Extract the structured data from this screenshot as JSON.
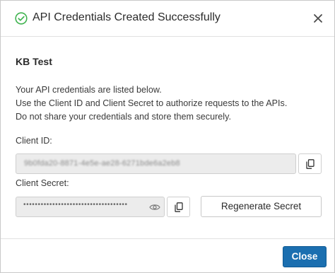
{
  "dialog": {
    "title": "API Credentials Created Successfully",
    "status_icon": "check-circle-icon",
    "close_icon": "close-icon"
  },
  "content": {
    "name": "KB Test",
    "description_lines": [
      "Your API credentials are listed below.",
      "Use the Client ID and Client Secret to authorize requests to the APIs.",
      "Do not share your credentials and store them securely."
    ]
  },
  "client_id": {
    "label": "Client ID:",
    "value": "9b0fda20-8871-4e5e-ae28-6271bde6a2eb8",
    "copy_icon": "copy-icon"
  },
  "client_secret": {
    "label": "Client Secret:",
    "masked_value": "••••••••••••••••••••••••••••••••••••",
    "visibility_icon": "eye-icon",
    "copy_icon": "copy-icon",
    "regenerate_label": "Regenerate Secret"
  },
  "footer": {
    "close_label": "Close"
  },
  "colors": {
    "success": "#3fb34f",
    "primary": "#1b6fb0",
    "input_bg": "#ececec"
  }
}
